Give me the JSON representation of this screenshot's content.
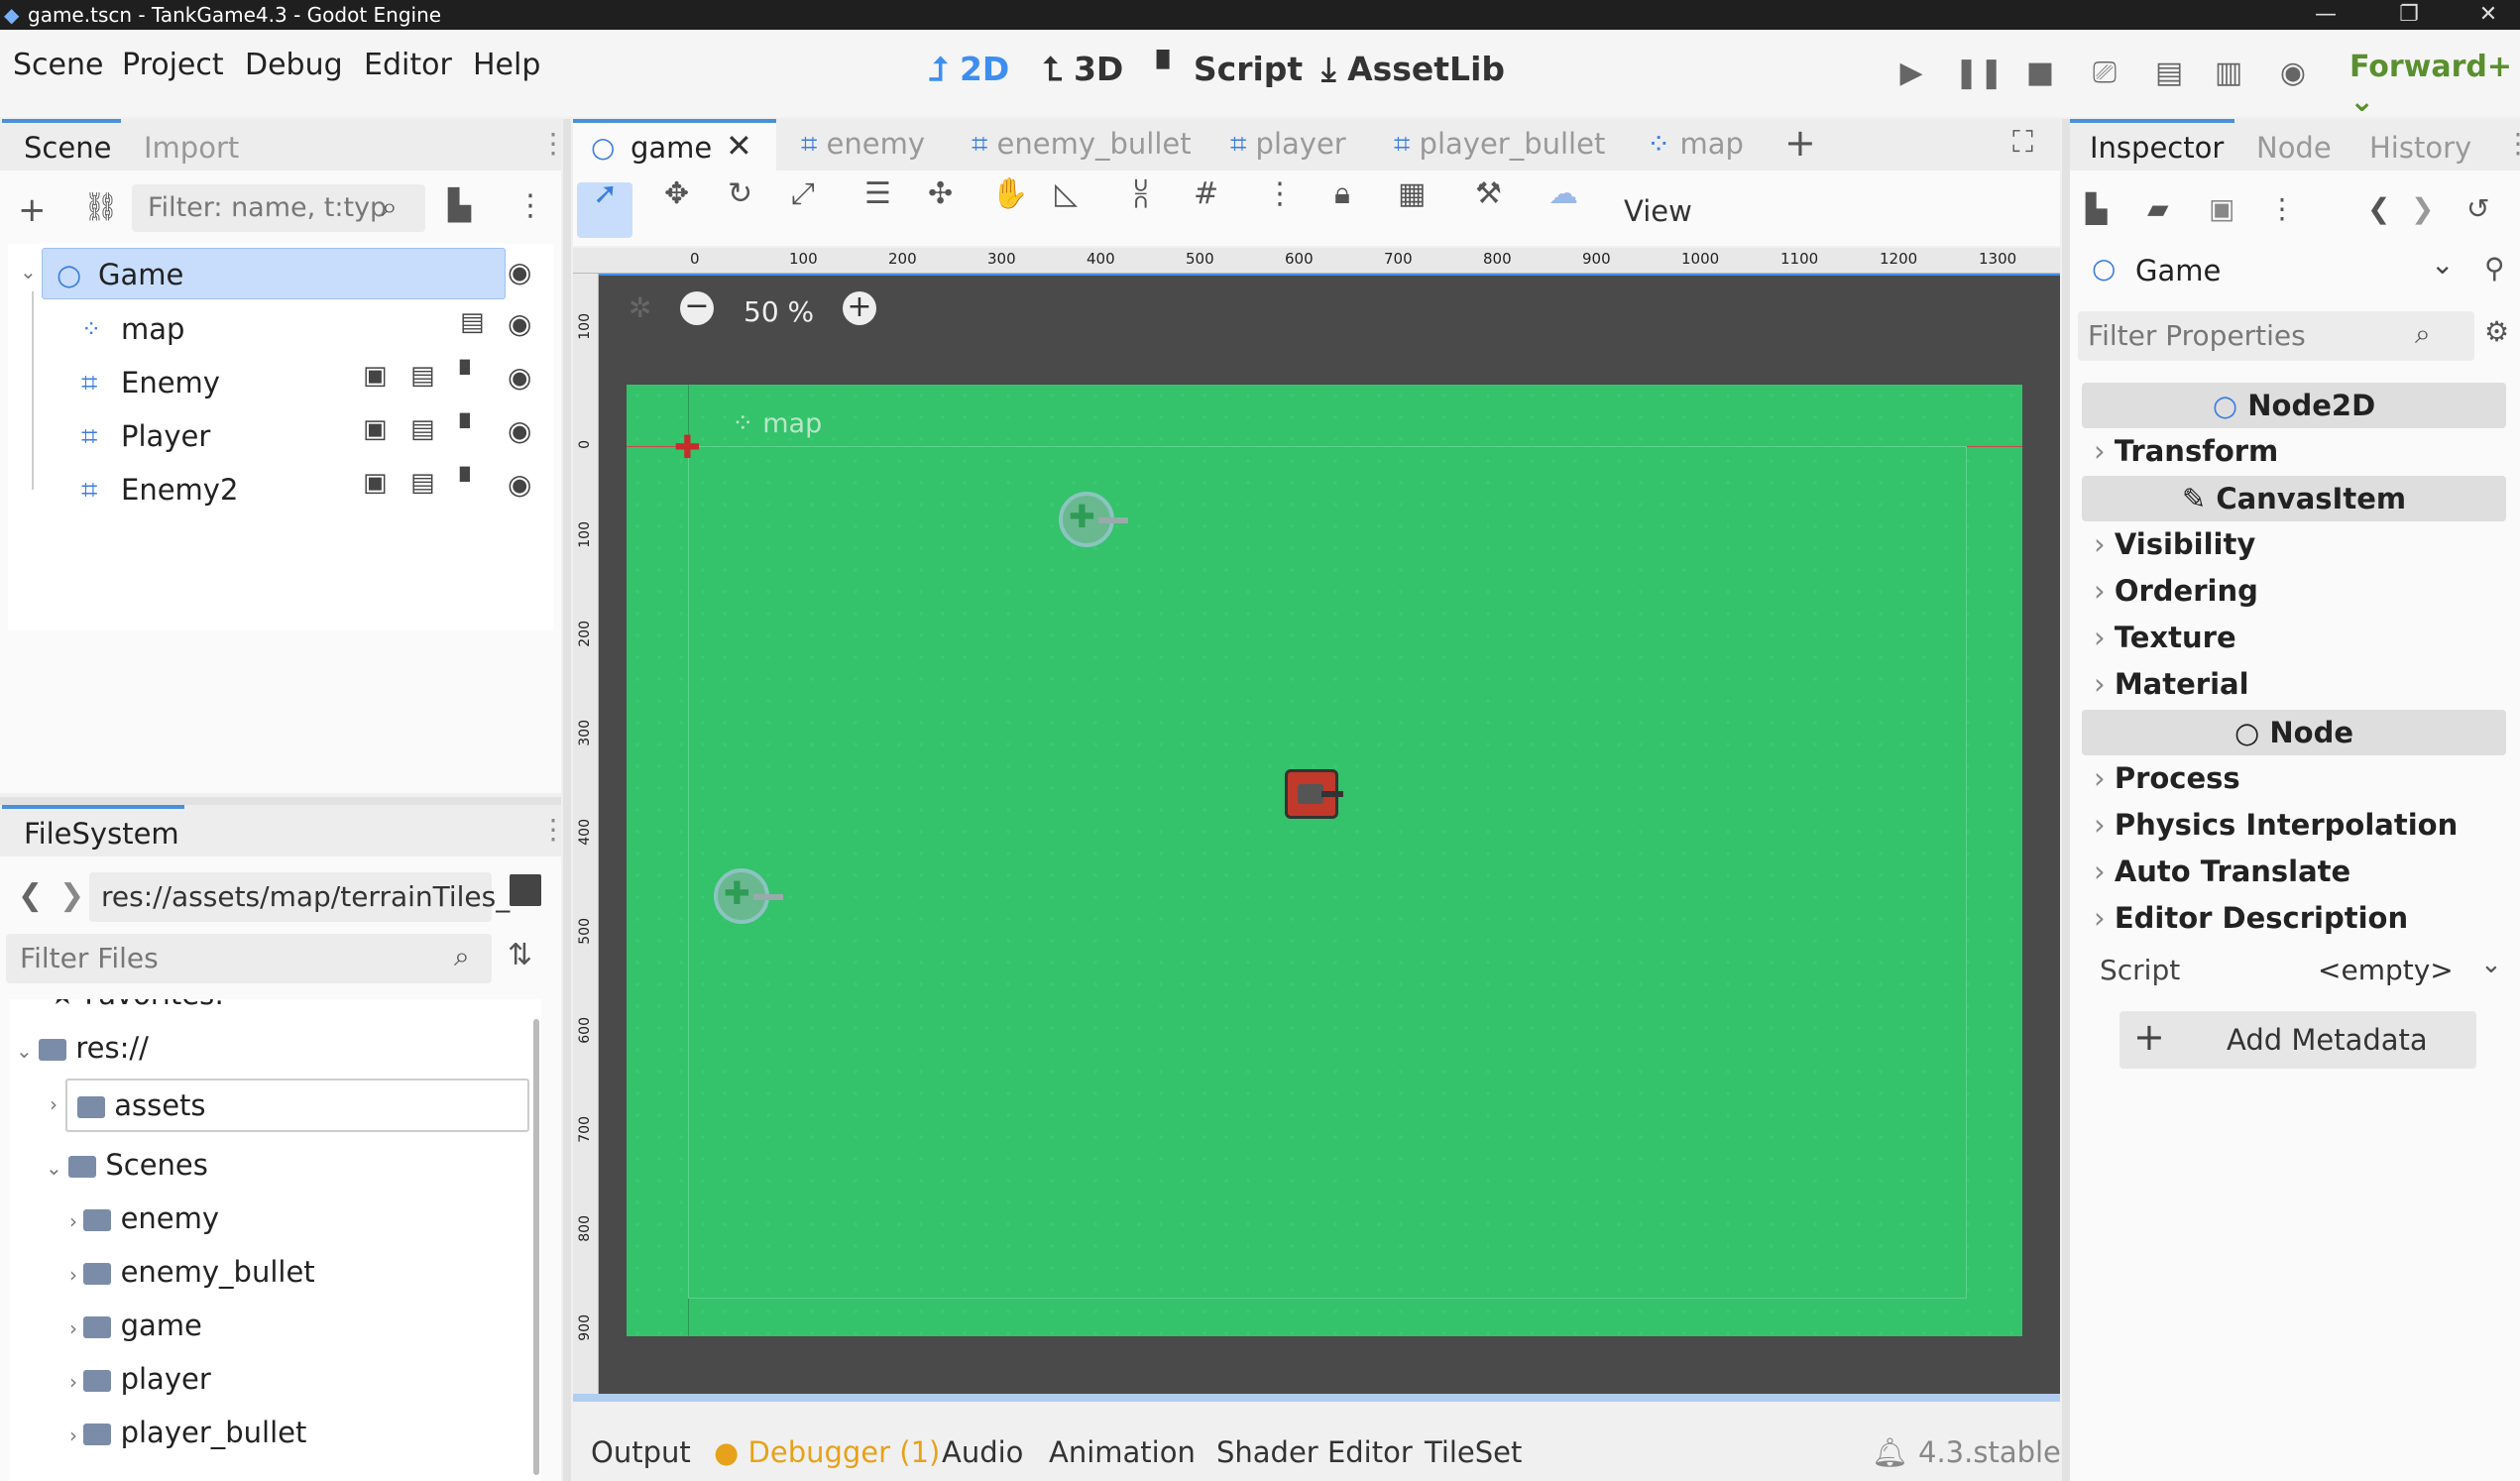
{
  "window": {
    "title": "game.tscn - TankGame4.3 - Godot Engine",
    "controls": [
      "—",
      "❐",
      "✕"
    ]
  },
  "menu": [
    "Scene",
    "Project",
    "Debug",
    "Editor",
    "Help"
  ],
  "workspaces": [
    {
      "label": "2D",
      "icon": "2d-icon"
    },
    {
      "label": "3D",
      "icon": "3d-icon"
    },
    {
      "label": "Script",
      "icon": "script-icon"
    },
    {
      "label": "AssetLib",
      "icon": "assetlib-icon"
    }
  ],
  "renderer": "Forward+",
  "scene_panel": {
    "tabs": [
      "Scene",
      "Import"
    ],
    "filter_placeholder": "Filter: name, t:typ",
    "nodes": [
      {
        "name": "Game"
      },
      {
        "name": "map"
      },
      {
        "name": "Enemy"
      },
      {
        "name": "Player"
      },
      {
        "name": "Enemy2"
      }
    ]
  },
  "filesystem": {
    "tab": "FileSystem",
    "path": "res://assets/map/terrainTiles_",
    "filter_placeholder": "Filter Files",
    "favorites": "Favorites:",
    "root": "res://",
    "items": [
      {
        "label": "assets"
      },
      {
        "label": "Scenes"
      },
      {
        "label": "enemy"
      },
      {
        "label": "enemy_bullet"
      },
      {
        "label": "game"
      },
      {
        "label": "player"
      },
      {
        "label": "player_bullet"
      }
    ]
  },
  "editor_tabs": [
    "game",
    "enemy",
    "enemy_bullet",
    "player",
    "player_bullet",
    "map"
  ],
  "toolbar": {
    "view_label": "View"
  },
  "zoom": "50 %",
  "ruler": {
    "h": [
      "0",
      "100",
      "200",
      "300",
      "400",
      "500",
      "600",
      "700",
      "800",
      "900",
      "1000",
      "1100",
      "1200",
      "1300"
    ],
    "v": [
      "100",
      "0",
      "100",
      "200",
      "300",
      "400",
      "500",
      "600",
      "700",
      "800",
      "900"
    ]
  },
  "viewport_label": "map",
  "inspector": {
    "tabs": [
      "Inspector",
      "Node",
      "History"
    ],
    "node": "Game",
    "filter_placeholder": "Filter Properties",
    "headers": [
      "Node2D",
      "CanvasItem",
      "Node"
    ],
    "node2d_sections": [
      "Transform"
    ],
    "canvas_sections": [
      "Visibility",
      "Ordering",
      "Texture",
      "Material"
    ],
    "node_sections": [
      "Process",
      "Physics Interpolation",
      "Auto Translate",
      "Editor Description"
    ],
    "script_label": "Script",
    "script_value": "<empty>",
    "add_metadata": "Add Metadata"
  },
  "bottom": {
    "tabs": [
      "Output",
      "Debugger (1)",
      "Audio",
      "Animation",
      "Shader Editor",
      "TileSet"
    ],
    "version": "4.3.stable"
  },
  "colors": {
    "accent": "#3d8ef0",
    "grass": "#34c26b",
    "renderer": "#5a8f2f",
    "debugger": "#e6a21a"
  }
}
